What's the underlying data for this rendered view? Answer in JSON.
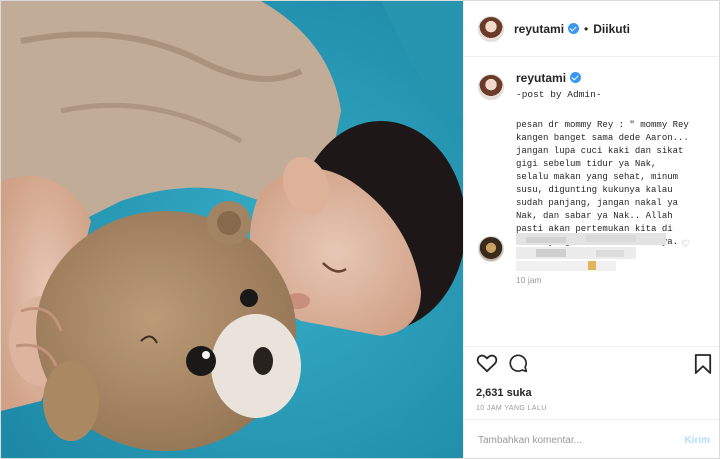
{
  "header": {
    "username": "reyutami",
    "separator": "•",
    "follow_label": "Diikuti"
  },
  "caption": {
    "username": "reyutami",
    "byline": "-post by Admin-",
    "message": "pesan dr mommy Rey : \" mommy Rey kangen banget sama dede Aaron... jangan lupa cuci kaki dan sikat gigi sebelum tidur ya Nak, selalu makan yang sehat, minum susu, digunting kukunya kalau sudah panjang, jangan nakal ya Nak, dan sabar ya Nak.. Allah pasti akan pertemukan kita di waktu yang terbaik menurutNya. Amin Allahuma Amin\".",
    "time": "10 jam"
  },
  "actions": {
    "likes": "2,631 suka",
    "posted": "10 JAM YANG LALU"
  },
  "comment_box": {
    "placeholder": "Tambahkan komentar...",
    "send_label": "Kirim"
  },
  "colors": {
    "blanket": "#2fa9c4",
    "verified": "#3897f0",
    "send_disabled": "#b2dffc"
  },
  "icons": {
    "like": "heart-icon",
    "comment": "comment-bubble-icon",
    "save": "bookmark-icon",
    "verified": "verified-badge-icon"
  }
}
